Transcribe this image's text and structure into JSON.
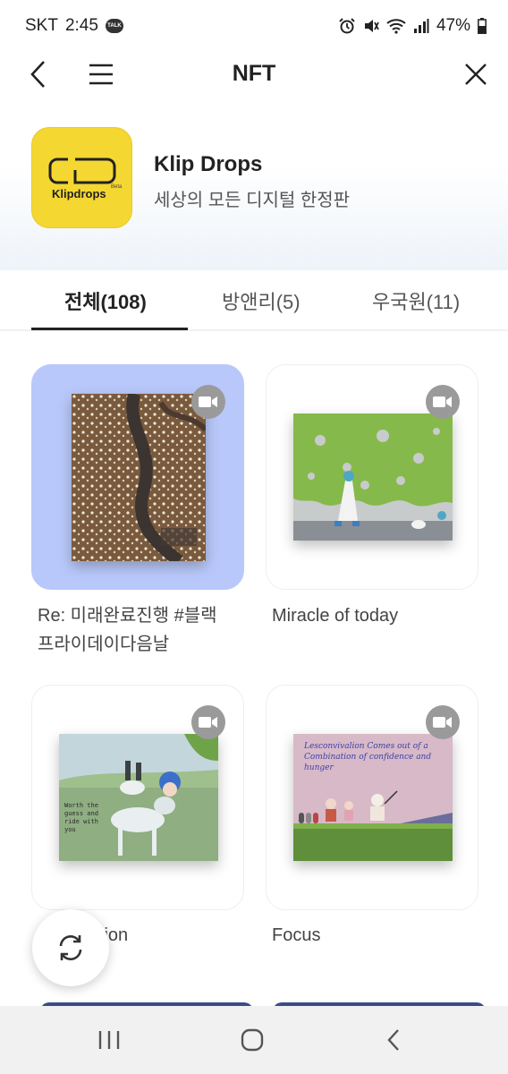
{
  "status_bar": {
    "carrier": "SKT",
    "time": "2:45",
    "talk_badge": "TALK",
    "battery": "47%"
  },
  "header": {
    "title": "NFT"
  },
  "brand": {
    "logo_text": "Klipdrops",
    "logo_beta": "Beta",
    "name": "Klip Drops",
    "subtitle": "세상의 모든 디지털 한정판"
  },
  "tabs": [
    {
      "label": "전체(108)"
    },
    {
      "label": "방앤리(5)"
    },
    {
      "label": "우국원(11)"
    }
  ],
  "cards": [
    {
      "title_line1": "Re: 미래완료진행 #블랙",
      "title_line2": "프라이데이다음날"
    },
    {
      "title_line1": "Miracle of today"
    },
    {
      "title_line1": "Connection"
    },
    {
      "title_line1": "Focus"
    }
  ],
  "art_texts": {
    "focus_caption": "Lesconvivalion Comes out of a Combination of confidence and hunger",
    "connection_scribble": "Worth the guess and ride with you"
  },
  "colors": {
    "accent_card_bg": "#b9c8fa",
    "logo_yellow": "#f5d732",
    "video_badge": "#9a9a9a",
    "peek_card": "#3a4c86"
  }
}
